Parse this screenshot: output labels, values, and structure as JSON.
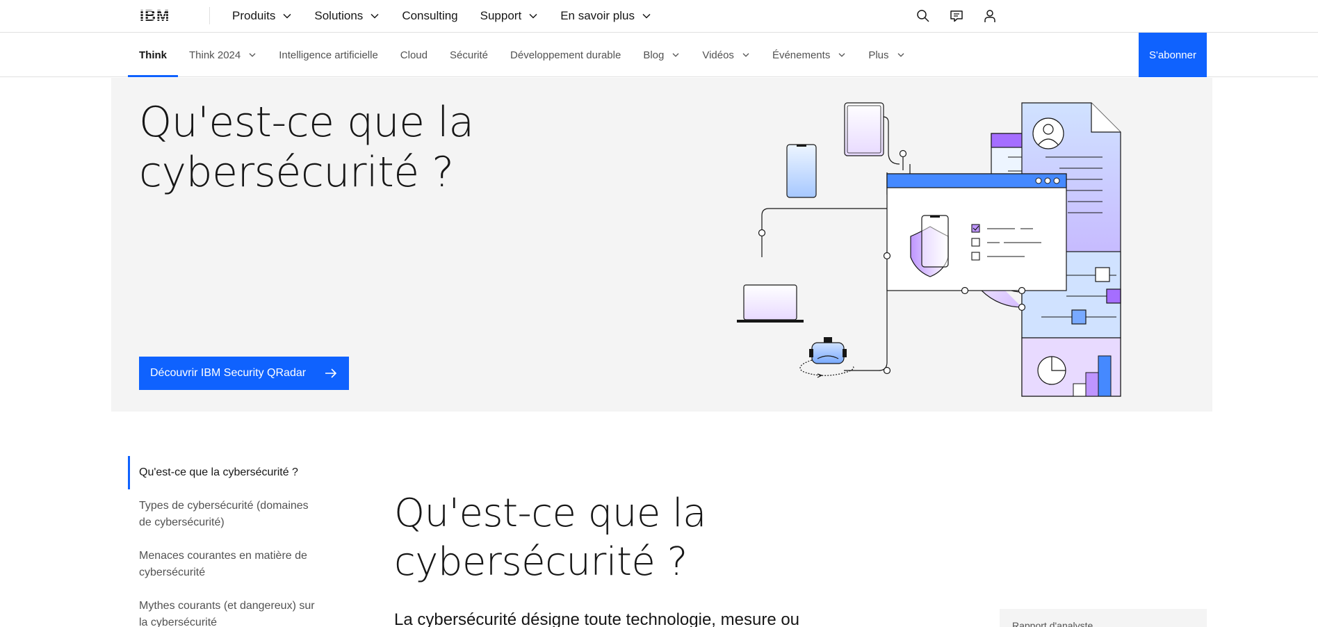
{
  "masthead": {
    "logo_text": "IBM",
    "nav": [
      {
        "label": "Produits",
        "has_menu": true
      },
      {
        "label": "Solutions",
        "has_menu": true
      },
      {
        "label": "Consulting",
        "has_menu": false
      },
      {
        "label": "Support",
        "has_menu": true
      },
      {
        "label": "En savoir plus",
        "has_menu": true
      }
    ],
    "icons": [
      "search-icon",
      "chat-icon",
      "user-icon"
    ]
  },
  "subnav": {
    "items": [
      {
        "label": "Think",
        "active": true,
        "has_menu": false
      },
      {
        "label": "Think 2024",
        "has_menu": true
      },
      {
        "label": "Intelligence artificielle",
        "has_menu": false
      },
      {
        "label": "Cloud",
        "has_menu": false
      },
      {
        "label": "Sécurité",
        "has_menu": false
      },
      {
        "label": "Développement durable",
        "has_menu": false
      },
      {
        "label": "Blog",
        "has_menu": true
      },
      {
        "label": "Vidéos",
        "has_menu": true
      },
      {
        "label": "Événements",
        "has_menu": true
      },
      {
        "label": "Plus",
        "has_menu": true
      }
    ],
    "subscribe_label": "S'abonner"
  },
  "hero": {
    "title": "Qu'est-ce que la cybersécurité ?",
    "cta_label": "Découvrir IBM Security QRadar"
  },
  "toc": {
    "items": [
      {
        "label": "Qu'est-ce que la cybersécurité ?",
        "active": true
      },
      {
        "label": "Types de cybersécurité (domaines de cybersécurité)"
      },
      {
        "label": "Menaces courantes en matière de cybersécurité"
      },
      {
        "label": "Mythes courants (et dangereux) sur la cybersécurité"
      }
    ]
  },
  "main": {
    "title": "Qu'est-ce que la cybersécurité ?",
    "lead": "La cybersécurité désigne toute technologie, mesure ou"
  },
  "side_card": {
    "label": "Rapport d'analyste"
  },
  "colors": {
    "accent": "#0f62fe",
    "hero_bg": "#f4f4f4",
    "purple": "#a56eff",
    "light_blue": "#d0e2ff"
  }
}
